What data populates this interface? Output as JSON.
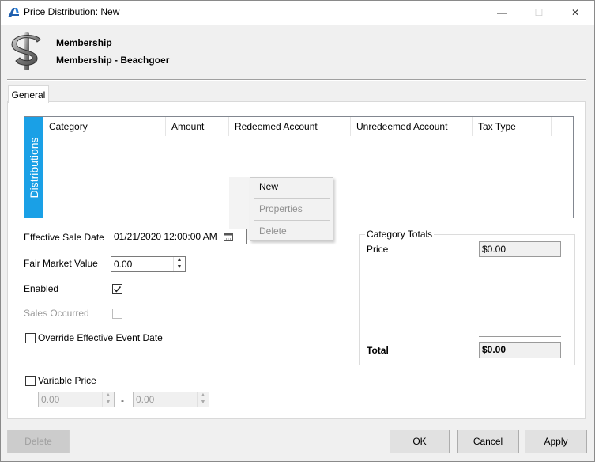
{
  "window": {
    "title": "Price Distribution: New",
    "minimize_glyph": "—",
    "maximize_glyph": "☐",
    "close_glyph": "✕"
  },
  "header": {
    "icon": "dollar-sign-icon",
    "line1": "Membership",
    "line2": "Membership - Beachgoer"
  },
  "tabs": [
    {
      "label": "General",
      "active": true
    }
  ],
  "distributions": {
    "label": "Distributions",
    "accent_color": "#1aa0e6",
    "columns": [
      "Category",
      "Amount",
      "Redeemed Account",
      "Unredeemed Account",
      "Tax Type"
    ],
    "rows": []
  },
  "context_menu": {
    "items": [
      {
        "label": "New",
        "enabled": true
      },
      {
        "label": "Properties",
        "enabled": false
      },
      {
        "label": "Delete",
        "enabled": false
      }
    ]
  },
  "form": {
    "effective_sale_date": {
      "label": "Effective Sale Date",
      "value": "01/21/2020 12:00:00 AM"
    },
    "fair_market_value": {
      "label": "Fair Market Value",
      "value": "0.00"
    },
    "enabled": {
      "label": "Enabled",
      "checked": true
    },
    "sales_occurred": {
      "label": "Sales Occurred",
      "checked": false,
      "disabled": true
    },
    "override_event_date": {
      "label": "Override Effective Event Date",
      "checked": false
    },
    "variable_price": {
      "label": "Variable Price",
      "checked": false,
      "min": "0.00",
      "max": "0.00",
      "separator": "-"
    }
  },
  "category_totals": {
    "title": "Category Totals",
    "price_label": "Price",
    "price_value": "$0.00",
    "total_label": "Total",
    "total_value": "$0.00"
  },
  "footer": {
    "delete_label": "Delete",
    "ok_label": "OK",
    "cancel_label": "Cancel",
    "apply_label": "Apply"
  }
}
